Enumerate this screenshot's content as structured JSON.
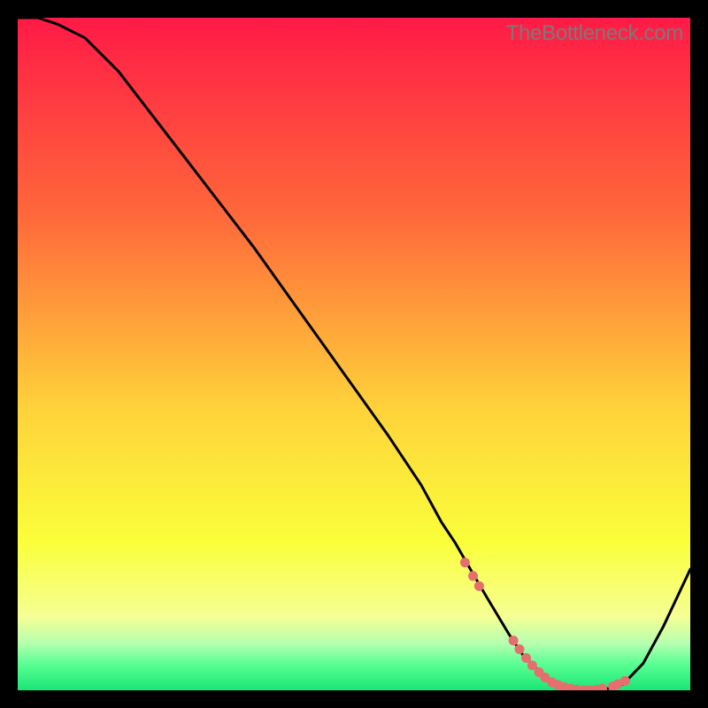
{
  "watermark": "TheBottleneck.com",
  "colors": {
    "gradient_top": "#ff1a47",
    "gradient_mid_upper": "#ff6a3a",
    "gradient_mid": "#ffd23a",
    "gradient_mid_lower": "#faff3a",
    "gradient_low": "#f6ff94",
    "gradient_green1": "#b6ffb0",
    "gradient_green2": "#5cff94",
    "gradient_bottom": "#19e676",
    "curve": "#000000",
    "marker": "#e66e6e",
    "frame_bg": "#000000"
  },
  "chart_data": {
    "type": "line",
    "title": "",
    "xlabel": "",
    "ylabel": "",
    "xlim": [
      0,
      100
    ],
    "ylim": [
      0,
      100
    ],
    "curve": {
      "x": [
        0,
        3,
        6,
        10,
        15,
        20,
        25,
        30,
        35,
        40,
        45,
        50,
        55,
        60,
        63,
        65,
        68,
        70,
        73,
        75,
        78,
        80,
        82,
        84,
        86,
        88,
        90,
        93,
        96,
        100
      ],
      "y": [
        100,
        100,
        99,
        97,
        92,
        85.5,
        79,
        72.5,
        66,
        59,
        52,
        45,
        38,
        30.5,
        25,
        22,
        16.8,
        13.4,
        8.4,
        5.4,
        2.3,
        0.8,
        0.2,
        0,
        0,
        0.3,
        0.9,
        4,
        9.5,
        18
      ]
    },
    "markers": {
      "x": [
        66.5,
        67.7,
        68.6,
        73.7,
        74.6,
        75.6,
        76.5,
        77.5,
        78.4,
        79.4,
        80.3,
        81.2,
        82.2,
        83.1,
        84.1,
        85.0,
        86.0,
        86.9,
        88.5,
        89.2,
        90.3
      ],
      "y": [
        19.0,
        17.0,
        15.5,
        7.4,
        6.1,
        4.8,
        3.7,
        2.7,
        1.9,
        1.2,
        0.8,
        0.5,
        0.25,
        0.1,
        0.02,
        0.02,
        0.1,
        0.25,
        0.6,
        0.9,
        1.4
      ]
    }
  }
}
